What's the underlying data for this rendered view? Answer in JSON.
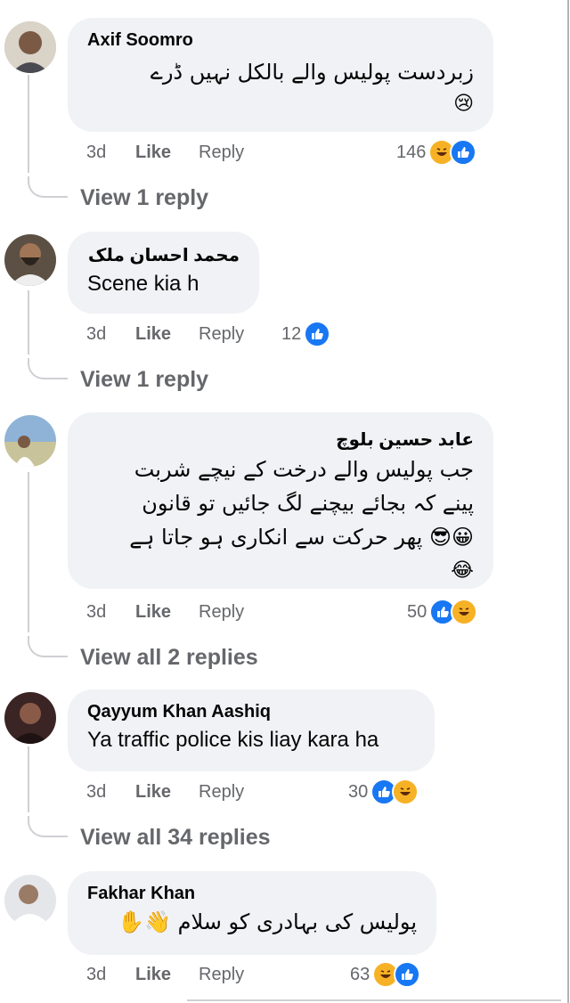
{
  "comments": [
    {
      "author": "Axif Soomro",
      "text_lines": [
        "زبردست پولیس والے بالکل نہیں ڈرے"
      ],
      "emoji": "😢",
      "time": "3d",
      "like": "Like",
      "reply": "Reply",
      "reaction_count": "146",
      "reactions": [
        "haha-icon",
        "like-icon"
      ],
      "view_replies": "View 1 reply"
    },
    {
      "author": "محمد احسان ملک",
      "text_lines": [
        "Scene kia h"
      ],
      "time": "3d",
      "like": "Like",
      "reply": "Reply",
      "reaction_count": "12",
      "reactions": [
        "like-icon"
      ],
      "view_replies": "View 1 reply"
    },
    {
      "author": "عابد حسین بلوچ",
      "text_lines": [
        "جب پولیس والے درخت کے نیچے شربت",
        "پینے کہ بجائے بیچنے لگ جائیں تو قانون",
        "پھر حرکت سے انکاری ہو جاتا ہے"
      ],
      "emoji": "😀😎",
      "emoji2": "😂",
      "time": "3d",
      "like": "Like",
      "reply": "Reply",
      "reaction_count": "50",
      "reactions": [
        "like-icon",
        "haha-icon"
      ],
      "view_replies": "View all 2 replies"
    },
    {
      "author": "Qayyum Khan Aashiq",
      "text_lines": [
        "Ya traffic police kis liay kara ha"
      ],
      "time": "3d",
      "like": "Like",
      "reply": "Reply",
      "reaction_count": "30",
      "reactions": [
        "like-icon",
        "haha-icon"
      ],
      "view_replies": "View all 34 replies"
    },
    {
      "author": "Fakhar Khan",
      "text_lines": [
        "پولیس کی بہادری کو سلام"
      ],
      "emoji": "👋✋",
      "time": "3d",
      "like": "Like",
      "reply": "Reply",
      "reaction_count": "63",
      "reactions": [
        "haha-icon",
        "like-icon"
      ]
    }
  ],
  "colors": {
    "like_blue": "#1877f2",
    "haha_yellow": "#f7b125",
    "bubble_bg": "#f0f2f5",
    "meta_gray": "#65676b"
  }
}
